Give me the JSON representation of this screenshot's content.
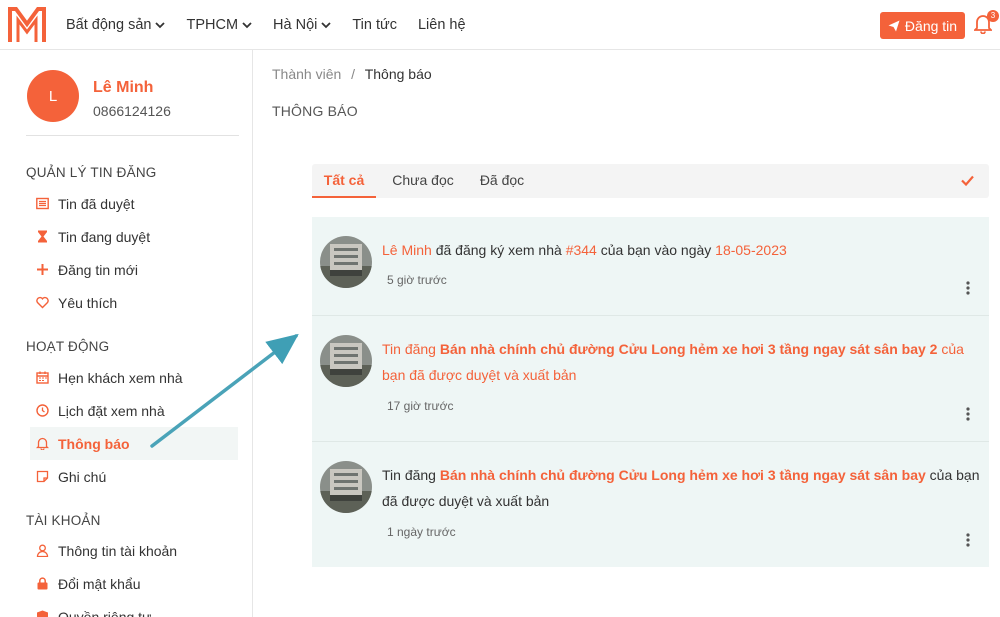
{
  "header": {
    "logo_icon": "m-logo-icon",
    "nav": [
      {
        "label": "Bất động sản",
        "dropdown": true
      },
      {
        "label": "TPHCM",
        "dropdown": true
      },
      {
        "label": "Hà Nội",
        "dropdown": true
      },
      {
        "label": "Tin tức",
        "dropdown": false
      },
      {
        "label": "Liên hệ",
        "dropdown": false
      }
    ],
    "post_button": "Đăng tin",
    "notification_count": "3",
    "accent_color": "#f4623a"
  },
  "sidebar": {
    "avatar_initial": "L",
    "user_name": "Lê Minh",
    "user_phone": "0866124126",
    "sections": [
      {
        "title": "QUẢN LÝ TIN ĐĂNG",
        "items": [
          {
            "label": "Tin đã duyệt",
            "icon": "list-icon"
          },
          {
            "label": "Tin đang duyệt",
            "icon": "hourglass-icon"
          },
          {
            "label": "Đăng tin mới",
            "icon": "plus-icon"
          },
          {
            "label": "Yêu thích",
            "icon": "heart-icon"
          }
        ]
      },
      {
        "title": "HOẠT ĐỘNG",
        "items": [
          {
            "label": "Hẹn khách xem nhà",
            "icon": "calendar-icon"
          },
          {
            "label": "Lịch đặt xem nhà",
            "icon": "clock-icon"
          },
          {
            "label": "Thông báo",
            "icon": "bell-icon",
            "active": true
          },
          {
            "label": "Ghi chú",
            "icon": "note-icon"
          }
        ]
      },
      {
        "title": "TÀI KHOẢN",
        "items": [
          {
            "label": "Thông tin tài khoản",
            "icon": "user-icon"
          },
          {
            "label": "Đổi mật khẩu",
            "icon": "lock-icon"
          },
          {
            "label": "Quyền riêng tư",
            "icon": "shield-icon"
          }
        ]
      }
    ]
  },
  "main": {
    "breadcrumb": {
      "parent": "Thành viên",
      "separator": "/",
      "current": "Thông báo"
    },
    "title": "THÔNG BÁO",
    "tabs": [
      {
        "label": "Tất cả",
        "active": true
      },
      {
        "label": "Chưa đọc",
        "active": false
      },
      {
        "label": "Đã đọc",
        "active": false
      }
    ],
    "notifications": [
      {
        "parts": [
          {
            "text": "Lê Minh",
            "style": "hl"
          },
          {
            "text": " đã đăng ký xem nhà ",
            "style": ""
          },
          {
            "text": "#344",
            "style": "hl"
          },
          {
            "text": " của bạn vào ngày ",
            "style": ""
          },
          {
            "text": "18-05-2023",
            "style": "hl"
          }
        ],
        "time": "5 giờ trước"
      },
      {
        "parts": [
          {
            "text": "Tin đăng ",
            "style": "hl"
          },
          {
            "text": "Bán nhà chính chủ đường Cửu Long hẻm xe hơi 3 tầng ngay sát sân bay 2",
            "style": "hl-b"
          },
          {
            "text": " của bạn đã được duyệt và xuất bản",
            "style": "hl"
          }
        ],
        "time": "17 giờ trước"
      },
      {
        "parts": [
          {
            "text": "Tin đăng ",
            "style": ""
          },
          {
            "text": "Bán nhà chính chủ đường Cửu Long hẻm xe hơi 3 tầng ngay sát sân bay",
            "style": "hl-b"
          },
          {
            "text": " của bạn đã được duyệt và xuất bản",
            "style": ""
          }
        ],
        "time": "1 ngày trước"
      }
    ]
  }
}
